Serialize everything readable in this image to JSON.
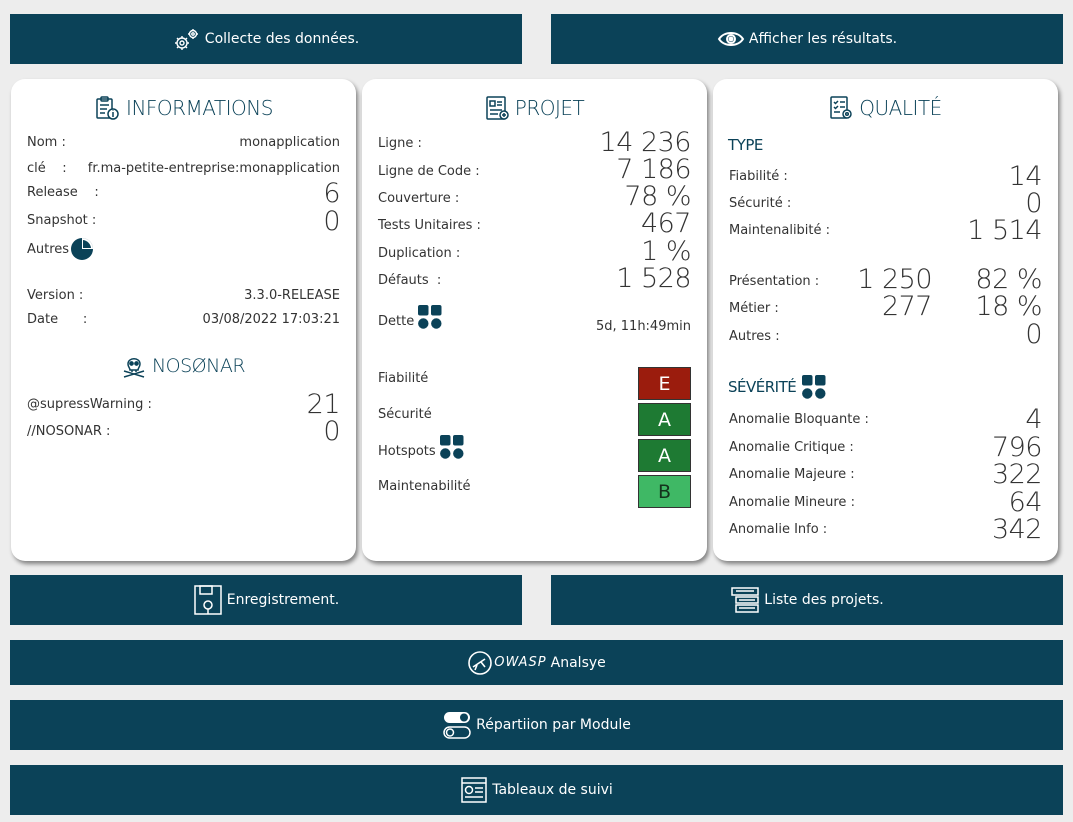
{
  "buttons": {
    "collecte": "Collecte des données.",
    "afficher": "Afficher les résultats.",
    "enregistrement": "Enregistrement.",
    "liste": "Liste des projets.",
    "owasp_logo": "OWASP",
    "owasp": "Analsye",
    "module": "Répartiion par Module",
    "suivi": "Tableaux de suivi"
  },
  "info": {
    "title": "INFORMATIONS",
    "nom_label": "Nom :",
    "nom_value": "monapplication",
    "cle_label": "clé    :",
    "cle_value": "fr.ma-petite-entreprise:monapplication",
    "release_label": "Release    :",
    "release_value": "6",
    "snapshot_label": "Snapshot :",
    "snapshot_value": "0",
    "autres_label": "Autres",
    "version_label": "Version :",
    "version_value": "3.3.0-RELEASE",
    "date_label": "Date      :",
    "date_value": "03/08/2022 17:03:21",
    "nosonar_title": "NOSØNAR",
    "supress_label": "@supressWarning :",
    "supress_value": "21",
    "nosonar_label": "//NOSONAR :",
    "nosonar_value": "0"
  },
  "projet": {
    "title": "PROJET",
    "rows": [
      {
        "label": "Ligne :",
        "value": "14 236"
      },
      {
        "label": "Ligne de Code :",
        "value": "7 186"
      },
      {
        "label": "Couverture :",
        "value": "78 %"
      },
      {
        "label": "Tests Unitaires :",
        "value": "467"
      },
      {
        "label": "Duplication :",
        "value": "1 %"
      },
      {
        "label": "Défauts  :",
        "value": "1 528"
      }
    ],
    "dette_label": "Dette",
    "dette_value": "5d, 11h:49min",
    "ratings": [
      {
        "label": "Fiabilité",
        "grade": "E",
        "color": "#9b1c0d"
      },
      {
        "label": "Sécurité",
        "grade": "A",
        "color": "#1e7a33"
      },
      {
        "label": "Hotspots",
        "grade": "A",
        "color": "#1e7a33"
      },
      {
        "label": "Maintenabilité",
        "grade": "B",
        "color": "#3fb865"
      }
    ]
  },
  "qualite": {
    "title": "QUALITÉ",
    "type_title": "TYPE",
    "fiabilite_label": "Fiabilité :",
    "fiabilite_value": "14",
    "securite_label": "Sécurité :",
    "securite_value": "0",
    "maintenabilite_label": "Maintenalibité :",
    "maintenabilite_value": "1 514",
    "presentation_label": "Présentation :",
    "presentation_value": "1 250",
    "presentation_pct": "82 %",
    "metier_label": "Métier :",
    "metier_value": "277",
    "metier_pct": "18 %",
    "autres_label": "Autres :",
    "autres_value": "0",
    "severite_title": "SÉVÉRITÉ",
    "severites": [
      {
        "label": "Anomalie Bloquante :",
        "value": "4"
      },
      {
        "label": "Anomalie Critique :",
        "value": "796"
      },
      {
        "label": "Anomalie Majeure :",
        "value": "322"
      },
      {
        "label": "Anomalie Mineure :",
        "value": "64"
      },
      {
        "label": "Anomalie Info :",
        "value": "342"
      }
    ]
  },
  "colors": {
    "accent": "#0b4258",
    "grade_e": "#9b1c0d",
    "grade_a": "#1e7a33",
    "grade_b": "#3fb865"
  },
  "icons": [
    "gears-icon",
    "eye-icon",
    "clipboard-info-icon",
    "skull-crossbones-icon",
    "report-icon",
    "checklist-gear-icon",
    "pie-chart-icon",
    "grid-icon",
    "save-disk-icon",
    "list-stack-icon",
    "owasp-logo-icon",
    "toggle-switch-icon",
    "dashboard-icon"
  ]
}
